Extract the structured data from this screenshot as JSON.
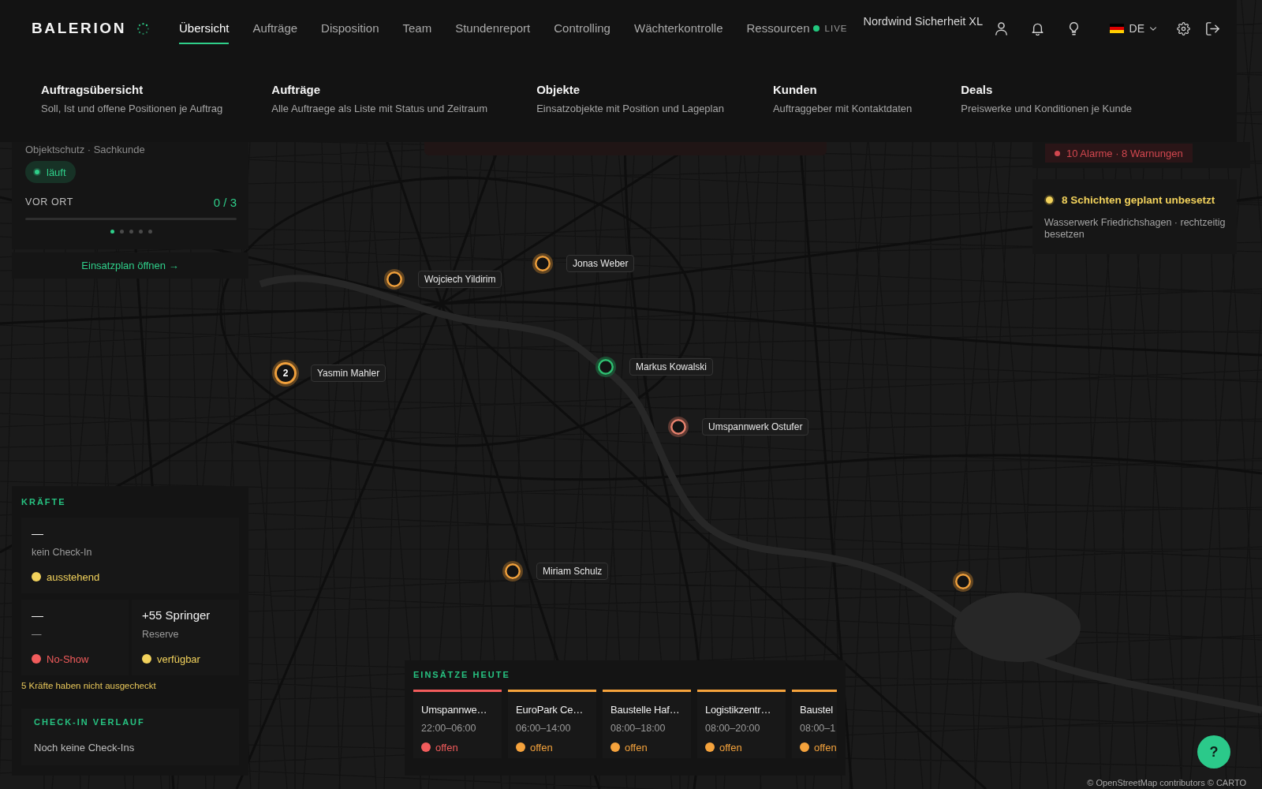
{
  "header": {
    "logo": "BALERION",
    "tabs": [
      {
        "label": "Übersicht",
        "selected": true
      },
      {
        "label": "Aufträge",
        "selected": false
      },
      {
        "label": "Disposition",
        "selected": false
      },
      {
        "label": "Team",
        "selected": false
      },
      {
        "label": "Stundenreport",
        "selected": false
      },
      {
        "label": "Controlling",
        "selected": false
      },
      {
        "label": "Wächterkontrolle",
        "selected": false
      },
      {
        "label": "Ressourcen",
        "selected": false
      }
    ],
    "live_label": "LIVE",
    "company": "Nordwind Sicherheit XL",
    "language": "DE"
  },
  "mega_menu": [
    {
      "title": "Auftragsübersicht",
      "description": "Soll, Ist und offene Positionen je Auftrag"
    },
    {
      "title": "Aufträge",
      "description": "Alle Auftraege als Liste mit Status und Zeitraum"
    },
    {
      "title": "Objekte",
      "description": "Einsatzobjekte mit Position und Lageplan"
    },
    {
      "title": "Kunden",
      "description": "Auftraggeber mit Kontaktdaten"
    },
    {
      "title": "Deals",
      "description": "Preiswerke und Konditionen je Kunde"
    }
  ],
  "order_card": {
    "subtitle": "Objektschutz · Sachkunde",
    "status": "läuft",
    "progress_label": "VOR ORT",
    "progress_count": "0 / 3",
    "level": 0,
    "pages": [
      {
        "selected": true
      },
      {
        "selected": false
      },
      {
        "selected": false
      },
      {
        "selected": false
      },
      {
        "selected": false
      }
    ],
    "link": "Einsatzplan öffnen →"
  },
  "alerts": {
    "badge": "10 Alarme · 8 Warnungen"
  },
  "notice": {
    "title": "8 Schichten geplant unbesetzt",
    "text": "Wasserwerk Friedrichshagen · rechtzeitig besetzen"
  },
  "map": {
    "markers": [
      {
        "label": "Wojciech Yildirim",
        "color": "#f0a03c"
      },
      {
        "label": "Jonas Weber",
        "color": "#f0a03c"
      },
      {
        "label": "Yasmin Mahler",
        "color": "#f0a03c",
        "count": "2"
      },
      {
        "label": "Markus Kowalski",
        "color": "#2fbf71"
      },
      {
        "label": "Umspannwerk Ostufer",
        "color": "#e8826e"
      },
      {
        "label": "Miriam Schulz",
        "color": "#f0a03c"
      },
      {
        "color": "#f0a03c"
      }
    ],
    "attribution": "© OpenStreetMap contributors © CARTO"
  },
  "forces": {
    "title": "KRÄFTE",
    "groups": [
      {
        "value": "—",
        "caption": "kein Check-In",
        "status": "ausstehend",
        "color": "#f2d25c"
      },
      {
        "value": "—",
        "caption": "—",
        "status": "No-Show",
        "color": "#f25c5c"
      },
      {
        "value": "+55 Springer",
        "caption": "Reserve",
        "status": "verfügbar",
        "color": "#f2d25c"
      }
    ],
    "warning": "5 Kräfte haben nicht ausgecheckt",
    "log_title": "CHECK-IN VERLAUF",
    "log_empty": "Noch keine Check-Ins"
  },
  "assignments": {
    "title": "EINSÄTZE HEUTE",
    "items": [
      {
        "name": "Umspannwe…",
        "time": "22:00–06:00",
        "status": "offen",
        "color": "#f25c5c"
      },
      {
        "name": "EuroPark Ce…",
        "time": "06:00–14:00",
        "status": "offen",
        "color": "#f5a33c"
      },
      {
        "name": "Baustelle Haf…",
        "time": "08:00–18:00",
        "status": "offen",
        "color": "#f5a33c"
      },
      {
        "name": "Logistikzentr…",
        "time": "08:00–20:00",
        "status": "offen",
        "color": "#f5a33c"
      },
      {
        "name": "Baustel",
        "time": "08:00–1",
        "status": "offen",
        "color": "#f5a33c"
      }
    ]
  },
  "help_button": "?"
}
